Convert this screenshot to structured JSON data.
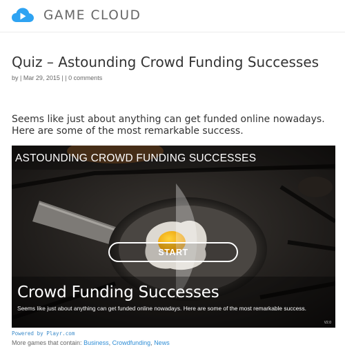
{
  "site": {
    "name": "GAME CLOUD",
    "logo_icon": "cloud-play-icon",
    "brand_color": "#2ea3f2"
  },
  "post": {
    "title": "Quiz – Astounding Crowd Funding Successes",
    "meta_by": "by",
    "meta_sep1": "|",
    "meta_date": "Mar 29, 2015",
    "meta_sep2": "|",
    "meta_sep3": "|",
    "meta_comments": "0 comments",
    "intro": "Seems like just about anything can get funded online nowadays. Here are some of the most remarkable success."
  },
  "embed": {
    "header_title": "ASTOUNDING CROWD FUNDING SUCCESSES",
    "start_label": "START",
    "big_title": "Crowd Funding Successes",
    "subtitle": "Seems like just about anything can get funded online nowadays. Here are some of the most remarkable success.",
    "version": "V2.0"
  },
  "footer": {
    "powered_by": "Powered by Playr.com",
    "more_games_prefix": "More games that contain:",
    "tags": [
      "Business",
      "Crowdfunding",
      "News"
    ],
    "link_color": "#2e8dd6"
  }
}
